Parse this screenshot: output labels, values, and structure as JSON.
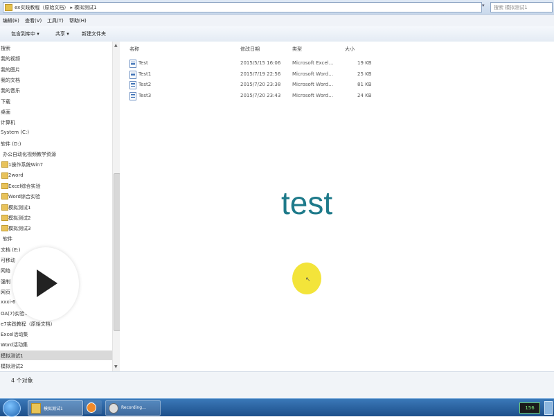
{
  "address_bar": {
    "path": "ex实践教程（原始文档） ▸ 模拟测试1",
    "search_placeholder": "搜索 模拟测试1"
  },
  "menu": [
    "编辑(E)",
    "查看(V)",
    "工具(T)",
    "帮助(H)"
  ],
  "toolbar": [
    "包含到库中 ▾",
    "共享 ▾",
    "新建文件夹"
  ],
  "sidebar": {
    "items": [
      {
        "label": "搜索",
        "folder": false,
        "indent": 0
      },
      {
        "label": "我的视频",
        "folder": false,
        "indent": 0
      },
      {
        "label": "我的图片",
        "folder": false,
        "indent": 0
      },
      {
        "label": "我的文档",
        "folder": false,
        "indent": 0
      },
      {
        "label": "我的音乐",
        "folder": false,
        "indent": 0
      },
      {
        "label": "下载",
        "folder": false,
        "indent": 0
      },
      {
        "label": "桌面",
        "folder": false,
        "indent": 0
      },
      {
        "label": "计算机",
        "folder": false,
        "indent": 0
      },
      {
        "label": "System (C:)",
        "folder": false,
        "indent": 0
      },
      {
        "label": "软件 (D:)",
        "folder": false,
        "indent": 0
      },
      {
        "label": "办公自动化视频教学资源",
        "folder": false,
        "indent": 1
      },
      {
        "label": "1操作系统Win7",
        "folder": true,
        "indent": 1
      },
      {
        "label": "2word",
        "folder": true,
        "indent": 1
      },
      {
        "label": "Excel综合实验",
        "folder": true,
        "indent": 1
      },
      {
        "label": "Word综合实验",
        "folder": true,
        "indent": 1
      },
      {
        "label": "模拟测试1",
        "folder": true,
        "indent": 1
      },
      {
        "label": "模拟测试2",
        "folder": true,
        "indent": 1
      },
      {
        "label": "模拟测试3",
        "folder": true,
        "indent": 1
      },
      {
        "label": "软件",
        "folder": false,
        "indent": 1
      },
      {
        "label": "文档 (E:)",
        "folder": false,
        "indent": 0
      },
      {
        "label": "可移动",
        "folder": false,
        "indent": 0
      },
      {
        "label": "网络",
        "folder": false,
        "indent": 0
      },
      {
        "label": "强制",
        "folder": false,
        "indent": 0
      },
      {
        "label": "网页",
        "folder": false,
        "indent": 0
      },
      {
        "label": "xxxi-6",
        "folder": false,
        "indent": 0
      },
      {
        "label": "OA(7)实验…",
        "folder": false,
        "indent": 0
      },
      {
        "label": "e7实践教程（原始文档）",
        "folder": false,
        "indent": 0
      },
      {
        "label": "Excel活动集",
        "folder": false,
        "indent": 0
      },
      {
        "label": "Word活动集",
        "folder": false,
        "indent": 0
      },
      {
        "label": "模拟测试1",
        "folder": false,
        "indent": 0,
        "selected": true
      },
      {
        "label": "模拟测试2",
        "folder": false,
        "indent": 0
      }
    ]
  },
  "columns": [
    "名称",
    "修改日期",
    "类型",
    "大小"
  ],
  "files": [
    {
      "name": "Test",
      "date": "2015/5/15 16:06",
      "type": "Microsoft Excel…",
      "size": "19 KB"
    },
    {
      "name": "Test1",
      "date": "2015/7/19 22:56",
      "type": "Microsoft Word…",
      "size": "25 KB"
    },
    {
      "name": "Test2",
      "date": "2015/7/20 23:38",
      "type": "Microsoft Word…",
      "size": "81 KB"
    },
    {
      "name": "Test3",
      "date": "2015/7/20 23:43",
      "type": "Microsoft Word…",
      "size": "24 KB"
    }
  ],
  "overlay_text": "test",
  "status_text": "4 个对象",
  "taskbar": {
    "items": [
      {
        "label": "模拟测试1",
        "icon": "folder-icon"
      },
      {
        "label": "",
        "icon": "media-player-icon"
      },
      {
        "label": "Recording…",
        "icon": "recorder-icon"
      }
    ],
    "tray_badge": "156"
  },
  "colors": {
    "overlay_text": "#1e7a8a",
    "cursor_highlight": "#f3e43a",
    "taskbar": "#2a64a3"
  }
}
